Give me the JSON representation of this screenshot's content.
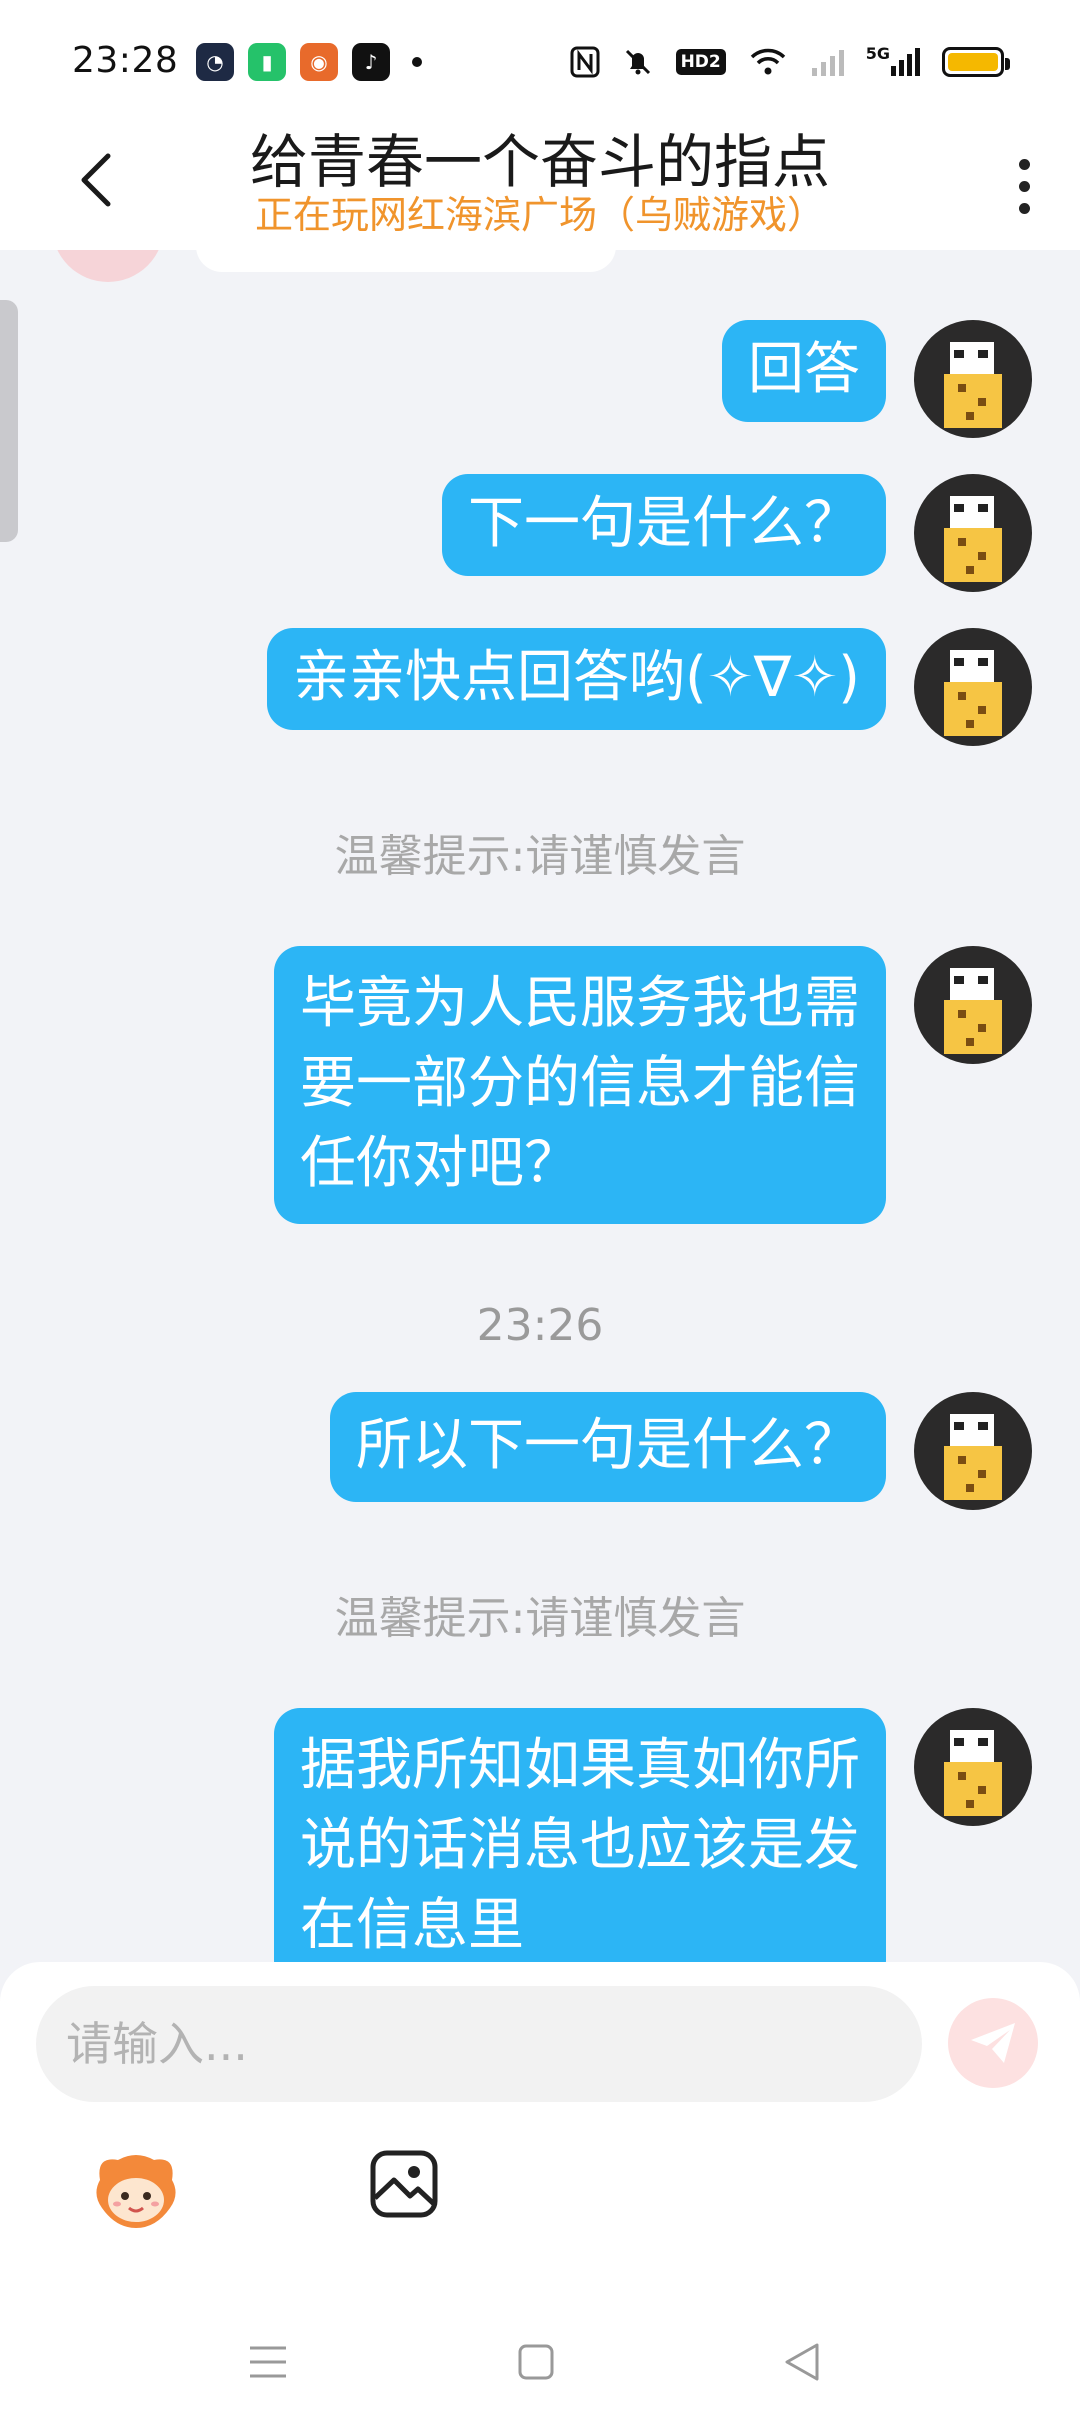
{
  "status_bar": {
    "time": "23:28",
    "network": "5G",
    "hd_badge": "HD2",
    "battery_color": "#f5b800"
  },
  "header": {
    "title": "给青春一个奋斗的指点",
    "subtitle": "正在玩网红海滨广场（乌贼游戏）"
  },
  "messages": [
    {
      "text": "回答"
    },
    {
      "text": "下一句是什么？"
    },
    {
      "text": "亲亲快点回答哟(✧∇✧)"
    },
    {
      "notice": "温馨提示:请谨慎发言"
    },
    {
      "text": "毕竟为人民服务我也需\n要一部分的信息才能信\n任你对吧？"
    },
    {
      "timestamp": "23:26"
    },
    {
      "text": "所以下一句是什么？"
    },
    {
      "notice": "温馨提示:请谨慎发言"
    },
    {
      "text": "据我所知如果真如你所\n说的话消息也应该是发\n在信息里"
    }
  ],
  "input": {
    "placeholder": "请输入..."
  },
  "colors": {
    "bubble": "#2cb5f5",
    "subtitle": "#f0942c",
    "notice": "#a8a8a8",
    "send_button": "#fde1e1"
  }
}
